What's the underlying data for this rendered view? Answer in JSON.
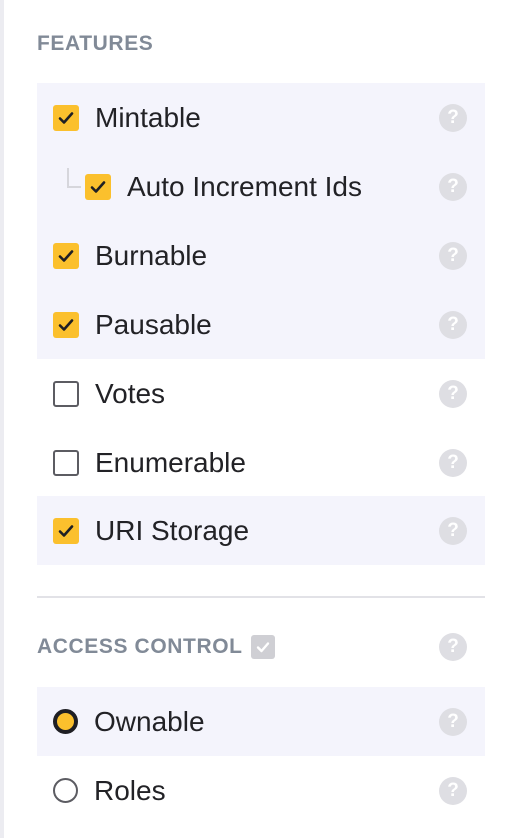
{
  "features": {
    "heading": "FEATURES",
    "items": [
      {
        "label": "Mintable",
        "checked": true,
        "help": "?"
      },
      {
        "label": "Auto Increment Ids",
        "checked": true,
        "help": "?"
      },
      {
        "label": "Burnable",
        "checked": true,
        "help": "?"
      },
      {
        "label": "Pausable",
        "checked": true,
        "help": "?"
      },
      {
        "label": "Votes",
        "checked": false,
        "help": "?"
      },
      {
        "label": "Enumerable",
        "checked": false,
        "help": "?"
      },
      {
        "label": "URI Storage",
        "checked": true,
        "help": "?"
      }
    ]
  },
  "access_control": {
    "heading": "ACCESS CONTROL",
    "enabled": true,
    "help": "?",
    "options": [
      {
        "label": "Ownable",
        "selected": true,
        "help": "?"
      },
      {
        "label": "Roles",
        "selected": false,
        "help": "?"
      }
    ]
  },
  "colors": {
    "accent": "#fbc02d",
    "selected_row_bg": "#f4f4fc",
    "heading": "#818a97",
    "help_icon": "#dedee3"
  },
  "icons": {
    "check": "checkmark-icon",
    "help": "question-mark-circle-icon"
  }
}
